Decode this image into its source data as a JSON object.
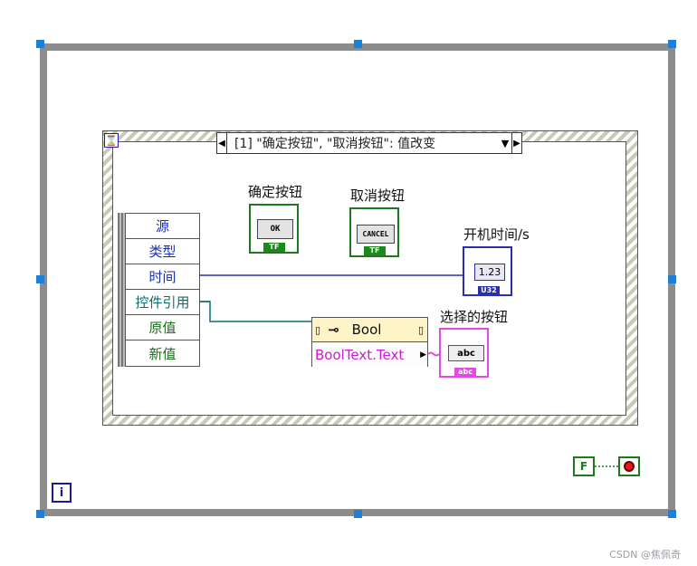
{
  "event_case": {
    "selector_label": "[1] \"确定按钮\", \"取消按钮\": 值改变",
    "data_node": [
      {
        "label": "源",
        "color": "#1a2fb5"
      },
      {
        "label": "类型",
        "color": "#1a2fb5"
      },
      {
        "label": "时间",
        "color": "#1a2fb5"
      },
      {
        "label": "控件引用",
        "color": "#0b6e6e"
      },
      {
        "label": "原值",
        "color": "#1b6e1b"
      },
      {
        "label": "新值",
        "color": "#1b6e1b"
      }
    ]
  },
  "controls": {
    "ok": {
      "label": "确定按钮",
      "button_text": "OK",
      "type_tag": "TF"
    },
    "cancel": {
      "label": "取消按钮",
      "button_text": "CANCEL",
      "type_tag": "TF"
    }
  },
  "indicators": {
    "time": {
      "label": "开机时间/s",
      "value": "1.23",
      "type_tag": "U32"
    },
    "selected": {
      "label": "选择的按钮",
      "value": "abc",
      "type_tag": "abc"
    }
  },
  "property_node": {
    "class": "Bool",
    "property": "BoolText.Text"
  },
  "loop": {
    "iteration_label": "i",
    "stop_constant": "F"
  },
  "colors": {
    "loop_frame": "#8c8c8c",
    "numeric_wire": "#2a2fb0",
    "reference_wire": "#0b6e6e",
    "string_wire": "#e34ae3",
    "boolean": "#1b7a1b"
  },
  "watermark": "CSDN @焦佩奇"
}
